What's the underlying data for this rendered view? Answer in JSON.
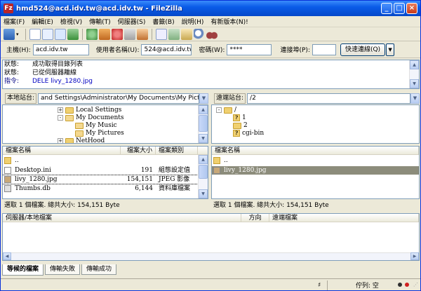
{
  "window": {
    "title": "hmd524@acd.idv.tw@acd.idv.tw - FileZilla",
    "app_icon": "Fz"
  },
  "menu": [
    "檔案(F)",
    "編輯(E)",
    "檢視(V)",
    "傳輸(T)",
    "伺服器(S)",
    "書籤(B)",
    "說明(H)",
    "有新版本(N)!"
  ],
  "toolbar_icons": [
    "site-manager-icon",
    "dropdown-arrow-icon",
    "message-log-icon",
    "local-tree-icon",
    "remote-tree-icon",
    "transfer-queue-icon",
    "refresh-icon",
    "process-queue-icon",
    "cancel-icon",
    "disconnect-icon",
    "reconnect-icon",
    "directory-comparison-icon",
    "sync-browsing-icon",
    "filter-icon",
    "search-icon",
    "binoculars-icon"
  ],
  "quickconnect": {
    "host_label": "主機(H):",
    "host_value": "acd.idv.tw",
    "user_label": "使用者名稱(U):",
    "user_value": "524@acd.idv.tw",
    "pass_label": "密碼(W):",
    "pass_value": "****",
    "port_label": "連接埠(P):",
    "port_value": "",
    "connect_label": "快速連線(Q)"
  },
  "log": [
    {
      "label": "狀態:",
      "msg": "成功取得目錄列表",
      "type": "status"
    },
    {
      "label": "狀態:",
      "msg": "已從伺服器離線",
      "type": "status"
    },
    {
      "label": "指令:",
      "msg": "DELE livy_1280.jpg",
      "type": "cmd"
    }
  ],
  "local": {
    "label": "本地站台:",
    "path": "and Settings\\Administrator\\My Documents\\My Pictures\\",
    "tree": [
      {
        "name": "Local Settings",
        "level": 0,
        "expander": "+"
      },
      {
        "name": "My Documents",
        "level": 0,
        "expander": "-"
      },
      {
        "name": "My Music",
        "level": 1,
        "expander": ""
      },
      {
        "name": "My Pictures",
        "level": 1,
        "expander": ""
      },
      {
        "name": "NetHood",
        "level": 0,
        "expander": "+"
      }
    ],
    "columns": [
      "檔案名稱",
      "檔案大小",
      "檔案類別"
    ],
    "files": [
      {
        "name": "..",
        "size": "",
        "type": "",
        "icon": "folder"
      },
      {
        "name": "Desktop.ini",
        "size": "191",
        "type": "組態設定值",
        "icon": "file"
      },
      {
        "name": "livy_1280.jpg",
        "size": "154,151",
        "type": "JPEG 影像",
        "icon": "image"
      },
      {
        "name": "Thumbs.db",
        "size": "6,144",
        "type": "資料庫檔案",
        "icon": "db"
      }
    ],
    "status": "選取 1 個檔案. 總共大小: 154,151 Byte"
  },
  "remote": {
    "label": "遠端站台:",
    "path": "/2",
    "tree": [
      {
        "name": "/",
        "level": 0,
        "expander": "-",
        "qmark": false
      },
      {
        "name": "1",
        "level": 1,
        "expander": "",
        "qmark": true
      },
      {
        "name": "2",
        "level": 1,
        "expander": "",
        "qmark": false
      },
      {
        "name": "cgi-bin",
        "level": 1,
        "expander": "",
        "qmark": true
      }
    ],
    "columns": [
      "檔案名稱"
    ],
    "files": [
      {
        "name": "..",
        "icon": "folder"
      },
      {
        "name": "livy_1280.jpg",
        "icon": "image"
      }
    ],
    "status": "選取 1 個檔案. 總共大小: 154,151 Byte"
  },
  "queue": {
    "columns": [
      "伺服器/本地檔案",
      "方向",
      "遠端檔案"
    ]
  },
  "queue_tabs": [
    "等候的檔案",
    "傳輸失敗",
    "傳輸成功"
  ],
  "statusbar": {
    "queue_label": "佇列: 空"
  },
  "colors": {
    "titlebar": "#0a5ce8",
    "selection": "#8c8c7b",
    "window_bg": "#ece9d8"
  }
}
